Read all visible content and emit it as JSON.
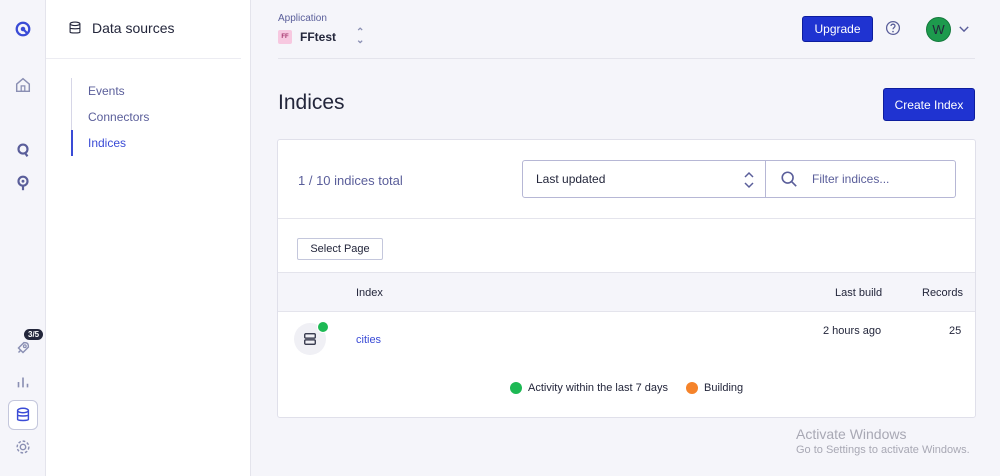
{
  "rail": {
    "badge": "3/5"
  },
  "sidebar": {
    "title": "Data sources",
    "items": [
      {
        "label": "Events"
      },
      {
        "label": "Connectors"
      },
      {
        "label": "Indices"
      }
    ]
  },
  "header": {
    "app_label": "Application",
    "app_chip": "FF",
    "app_name": "FFtest",
    "upgrade_label": "Upgrade",
    "avatar_initial": "W"
  },
  "main": {
    "title": "Indices",
    "create_label": "Create Index",
    "total_text": "1 / 10 indices total",
    "sort_value": "Last updated",
    "filter_placeholder": "Filter indices...",
    "select_page_label": "Select Page",
    "columns": {
      "index": "Index",
      "last_build": "Last build",
      "records": "Records"
    },
    "rows": [
      {
        "name": "cities",
        "last_build": "2 hours ago",
        "records": "25"
      }
    ],
    "legend": {
      "activity": "Activity within the last 7 days",
      "building": "Building"
    }
  },
  "watermark": {
    "line1": "Activate Windows",
    "line2": "Go to Settings to activate Windows."
  },
  "colors": {
    "accent": "#1f33d1",
    "activity": "#1db954",
    "building": "#f5832a"
  }
}
